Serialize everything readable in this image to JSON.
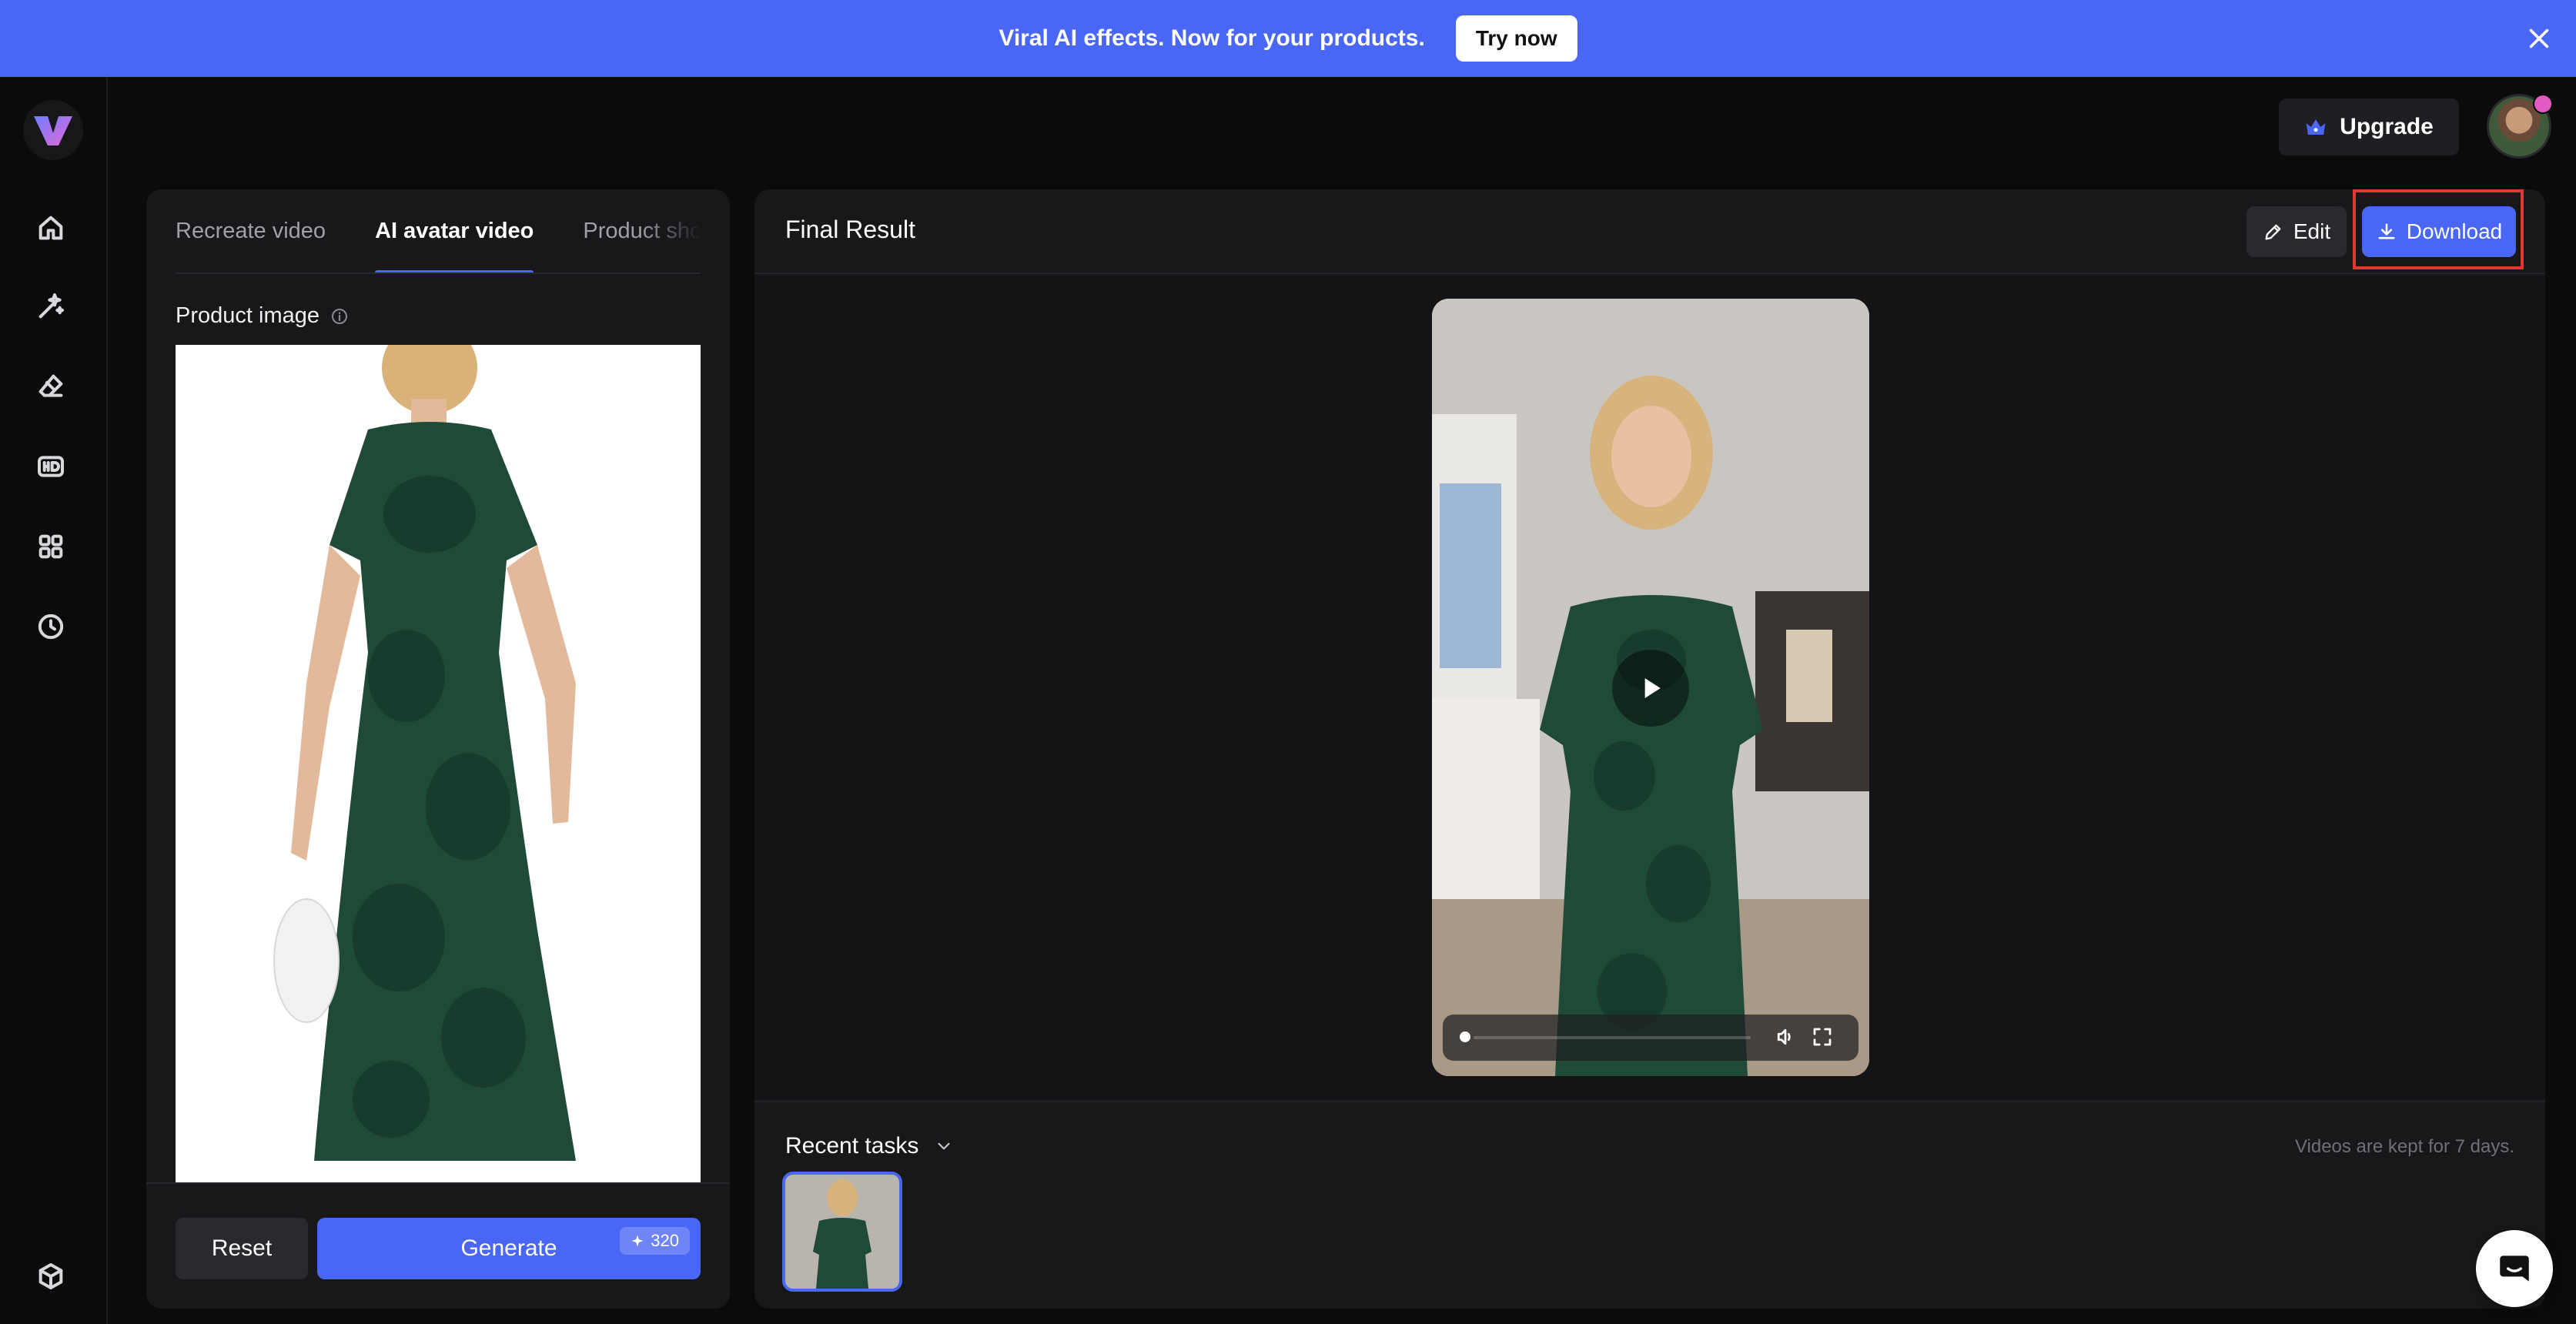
{
  "banner": {
    "text": "Viral AI effects. Now for your products.",
    "cta_label": "Try now"
  },
  "header": {
    "upgrade_label": "Upgrade"
  },
  "left_panel": {
    "tabs": [
      {
        "label": "Recreate video",
        "active": false
      },
      {
        "label": "AI avatar video",
        "active": true
      },
      {
        "label": "Product sho",
        "active": false
      }
    ],
    "product_image_label": "Product image",
    "reset_label": "Reset",
    "generate_label": "Generate",
    "credits": "320"
  },
  "right_panel": {
    "title": "Final Result",
    "edit_label": "Edit",
    "download_label": "Download",
    "recent_tasks_label": "Recent tasks",
    "retention_note": "Videos are kept for 7 days."
  },
  "colors": {
    "accent": "#4a66f5",
    "highlight": "#e03a2e",
    "panel": "#18181b"
  },
  "icons": {
    "rail": [
      "home-icon",
      "magic-wand-icon",
      "eraser-icon",
      "hd-icon",
      "apps-grid-icon",
      "history-clock-icon",
      "cube-icon"
    ]
  }
}
